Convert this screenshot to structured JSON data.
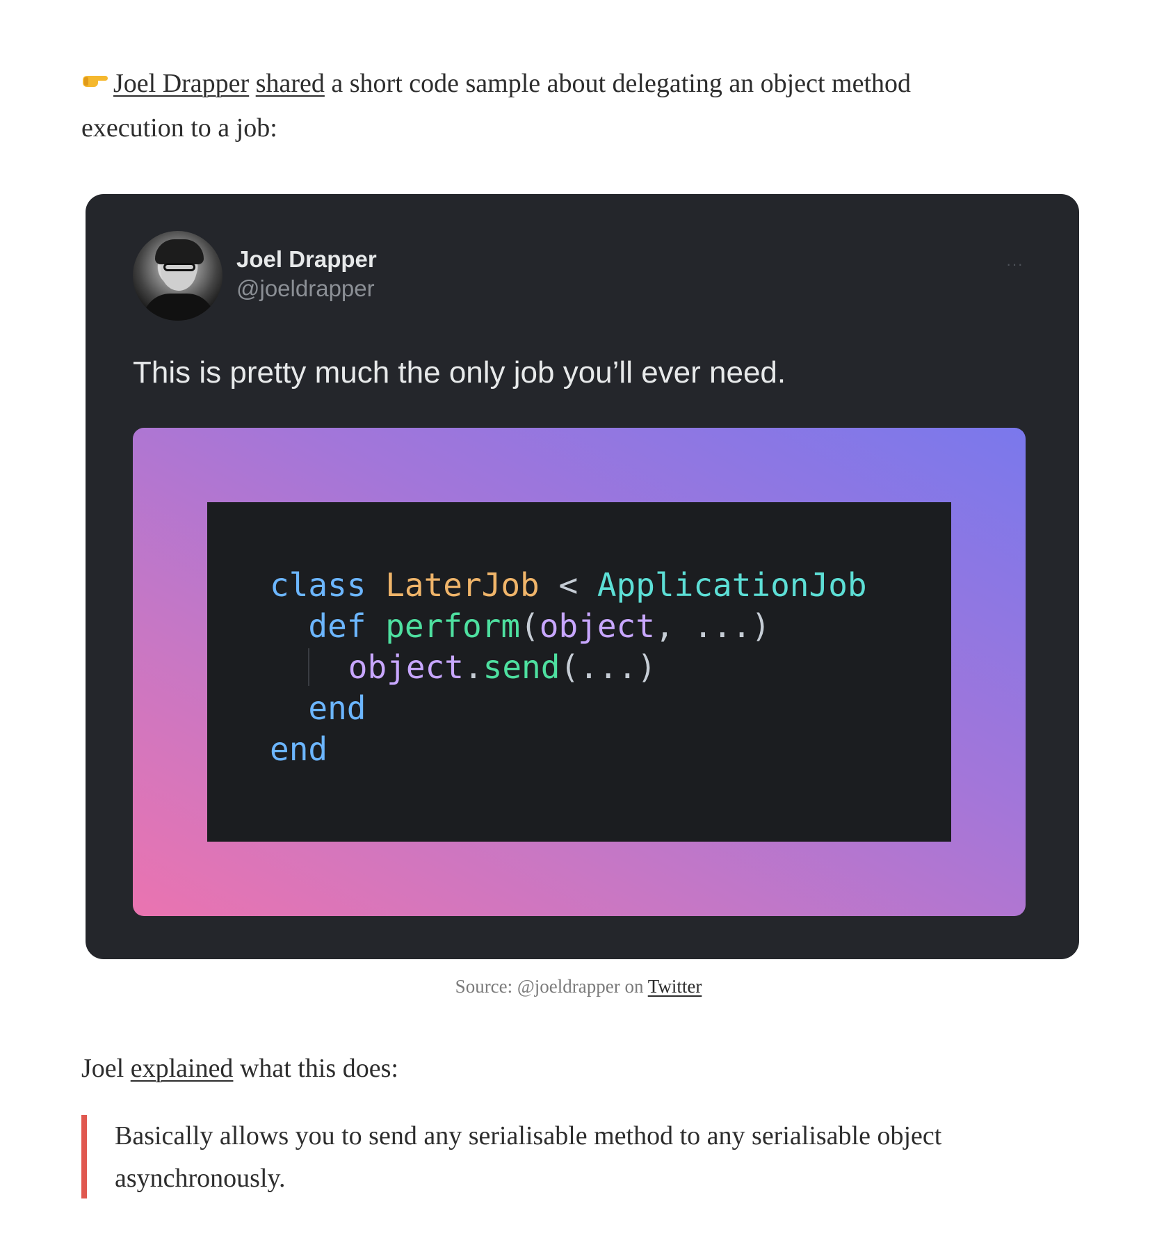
{
  "intro": {
    "link_author": "Joel Drapper",
    "link_shared": "shared",
    "text_rest_line1": " a short code sample about delegating an object method",
    "text_line2": "execution to a job:"
  },
  "tweet": {
    "author_name": "Joel Drapper",
    "author_handle": "@joeldrapper",
    "more_icon": "···",
    "text": "This is pretty much the only job you’ll ever need.",
    "code": {
      "line1": {
        "kw": "class",
        "cls": "LaterJob",
        "op": "<",
        "sup": "ApplicationJob"
      },
      "line2": {
        "kw": "def",
        "fn": "perform",
        "p1": "(",
        "var": "object",
        "p2": ", ...)"
      },
      "line3": {
        "var": "object",
        "dot": ".",
        "fn": "send",
        "p": "(...)"
      },
      "line4": {
        "kw": "end"
      },
      "line5": {
        "kw": "end"
      }
    }
  },
  "caption": {
    "prefix": "Source: @joeldrapper on ",
    "link": "Twitter"
  },
  "paragraph": {
    "prefix": "Joel ",
    "link": "explained",
    "suffix": " what this does:"
  },
  "blockquote": {
    "text": "Basically allows you to send any serialisable method to any serialisable object asynchronously."
  },
  "colors": {
    "quote_bar": "#e0584f",
    "card_bg": "#24262b",
    "gradient_start": "#ea74b0",
    "gradient_end": "#7a78ec"
  }
}
